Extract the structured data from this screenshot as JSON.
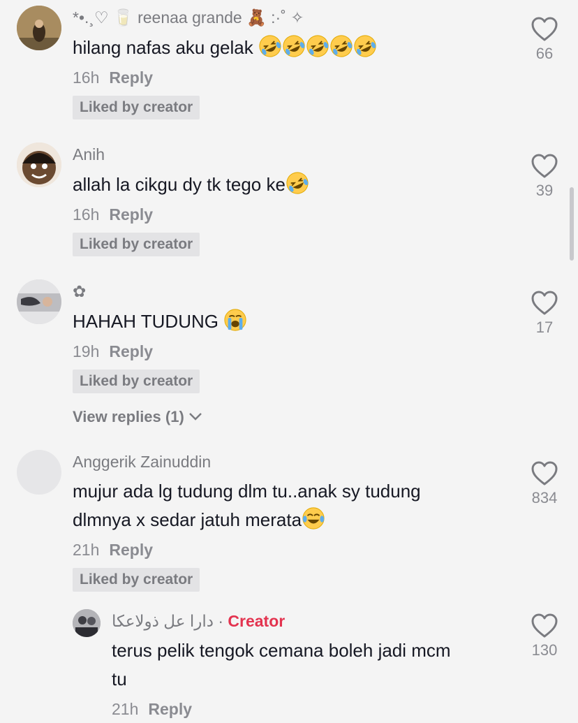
{
  "comments": [
    {
      "username": "*•.¸♡ 🥛 reenaa grande 🧸 :·˚ ✧",
      "text": "hilang nafas aku gelak",
      "emoji": "rofl-emoji x5",
      "time": "16h",
      "reply": "Reply",
      "badge": "Liked by creator",
      "likes": "66"
    },
    {
      "username": "Anih",
      "text": "allah la cikgu dy tk tego ke",
      "emoji": "rofl-emoji",
      "time": "16h",
      "reply": "Reply",
      "badge": "Liked by creator",
      "likes": "39"
    },
    {
      "username": "✿",
      "text": "HAHAH TUDUNG",
      "emoji": "loudly-crying-emoji",
      "time": "19h",
      "reply": "Reply",
      "badge": "Liked by creator",
      "likes": "17",
      "view_replies": "View replies (1)"
    },
    {
      "username": "Anggerik Zainuddin",
      "text_line1": "mujur ada lg tudung dlm tu..anak sy tudung",
      "text_line2": "dlmnya x sedar jatuh merata",
      "emoji": "tears-of-joy-emoji",
      "time": "21h",
      "reply": "Reply",
      "badge": "Liked by creator",
      "likes": "834"
    }
  ],
  "creator_reply": {
    "username": "دارا عل ذولاعكا",
    "separator": " · ",
    "creator_label": "Creator",
    "text_line1": "terus pelik tengok cemana boleh jadi mcm",
    "text_line2": "tu",
    "time": "21h",
    "reply": "Reply",
    "likes": "130"
  },
  "colors": {
    "background": "#f4f4f4",
    "creator_accent": "#e3334f",
    "badge_bg": "#e3e3e5"
  }
}
